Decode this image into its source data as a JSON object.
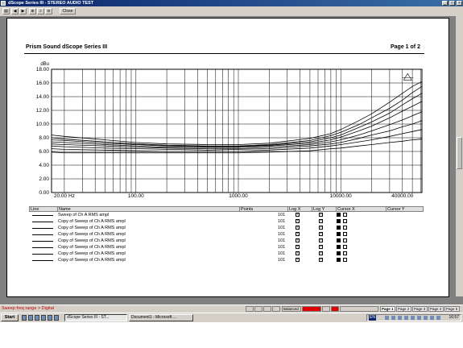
{
  "window": {
    "title": "dScope Series III - STEREO AUDIO TEST",
    "close_label": "Close"
  },
  "report": {
    "header_left": "Prism Sound dScope Series III",
    "header_right": "Page 1 of 2"
  },
  "chart_data": {
    "type": "line",
    "ylabel": "dBu",
    "x_scale": "log",
    "xlim": [
      15,
      62000
    ],
    "ylim": [
      0,
      18
    ],
    "y_ticks": [
      "0.00",
      "2.00",
      "4.00",
      "6.00",
      "8.00",
      "10.00",
      "12.00",
      "14.00",
      "16.00",
      "18.00"
    ],
    "x_ticks": [
      {
        "v": 20,
        "label": "20.00 Hz"
      },
      {
        "v": 100,
        "label": "100.00"
      },
      {
        "v": 1000,
        "label": "1000.00"
      },
      {
        "v": 10000,
        "label": "10000.00"
      },
      {
        "v": 40000,
        "label": "40000.00"
      }
    ],
    "grid": true,
    "x": [
      15,
      20,
      50,
      100,
      200,
      500,
      1000,
      2000,
      5000,
      8000,
      10000,
      15000,
      20000,
      30000,
      40000,
      50000,
      62000
    ],
    "series": [
      {
        "values": [
          8.4,
          8.2,
          7.7,
          7.3,
          7.1,
          7.0,
          7.0,
          7.2,
          7.9,
          8.6,
          9.2,
          10.5,
          11.5,
          13.2,
          14.5,
          15.5,
          16.2
        ]
      },
      {
        "values": [
          8.0,
          7.8,
          7.4,
          7.1,
          6.9,
          6.8,
          6.8,
          7.0,
          7.6,
          8.3,
          8.8,
          9.9,
          10.9,
          12.3,
          13.5,
          14.6,
          15.5
        ]
      },
      {
        "values": [
          7.7,
          7.6,
          7.2,
          7.0,
          6.8,
          6.7,
          6.7,
          6.9,
          7.4,
          8.0,
          8.4,
          9.5,
          10.3,
          11.6,
          12.8,
          13.7,
          14.5
        ]
      },
      {
        "values": [
          7.4,
          7.3,
          7.0,
          6.8,
          6.6,
          6.6,
          6.6,
          6.8,
          7.2,
          7.7,
          8.1,
          9.0,
          9.7,
          10.9,
          11.9,
          12.6,
          13.3
        ]
      },
      {
        "values": [
          7.1,
          7.0,
          6.8,
          6.6,
          6.5,
          6.4,
          6.4,
          6.6,
          7.0,
          7.4,
          7.7,
          8.4,
          9.0,
          9.9,
          10.6,
          11.2,
          11.8
        ]
      },
      {
        "values": [
          6.8,
          6.7,
          6.5,
          6.4,
          6.3,
          6.2,
          6.3,
          6.4,
          6.8,
          7.1,
          7.3,
          7.9,
          8.4,
          9.0,
          9.6,
          10.0,
          10.5
        ]
      },
      {
        "values": [
          6.4,
          6.3,
          6.2,
          6.1,
          6.0,
          6.0,
          6.0,
          6.2,
          6.5,
          6.8,
          7.0,
          7.4,
          7.7,
          8.2,
          8.6,
          8.9,
          9.2
        ]
      },
      {
        "values": [
          5.9,
          5.8,
          5.8,
          5.8,
          5.8,
          5.8,
          5.8,
          5.9,
          6.1,
          6.4,
          6.5,
          6.8,
          7.0,
          7.3,
          7.5,
          7.7,
          7.8
        ]
      }
    ]
  },
  "legend": {
    "columns": [
      "Line",
      "Name",
      "Points",
      "Log X",
      "Log Y",
      "Cursor X",
      "Cursor Y"
    ],
    "rows": [
      {
        "name": "Sweep of Ch A RMS ampl",
        "points": "101"
      },
      {
        "name": "Copy of Sweep of Ch A RMS ampl",
        "points": "101"
      },
      {
        "name": "Copy of Sweep of Ch A RMS ampl",
        "points": "101"
      },
      {
        "name": "Copy of Sweep of Ch A RMS ampl",
        "points": "101"
      },
      {
        "name": "Copy of Sweep of Ch A RMS ampl",
        "points": "101"
      },
      {
        "name": "Copy of Sweep of Ch A RMS ampl",
        "points": "101"
      },
      {
        "name": "Copy of Sweep of Ch A RMS ampl",
        "points": "101"
      },
      {
        "name": "Copy of Sweep of Ch A RMS ampl",
        "points": "101"
      }
    ]
  },
  "status": {
    "message": "Sweep freq range > Digital",
    "mode": "Balanced",
    "pages": [
      "Page 1",
      "Page 2",
      "Page 3",
      "Page 4",
      "Page 5"
    ]
  },
  "taskbar": {
    "start_label": "Start",
    "tasks": [
      "dScope Series III - ST...",
      "Document1 - Microsoft ..."
    ],
    "clock": "16:57",
    "lang": "EN"
  }
}
